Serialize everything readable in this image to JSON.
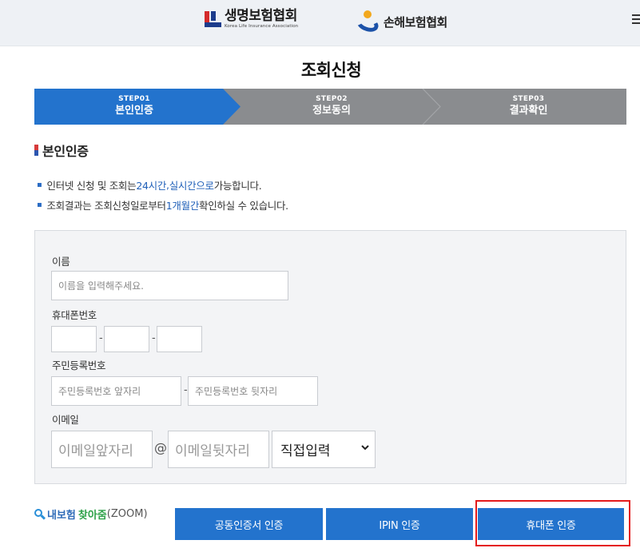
{
  "header": {
    "logo_life_kr": "생명보험협회",
    "logo_life_en": "Korea Life Insurance Association",
    "logo_nonlife": "손해보험협회"
  },
  "page": {
    "title": "조회신청"
  },
  "steps": [
    {
      "num": "STEP01",
      "label": "본인인증",
      "active": true
    },
    {
      "num": "STEP02",
      "label": "정보동의",
      "active": false
    },
    {
      "num": "STEP03",
      "label": "결과확인",
      "active": false
    }
  ],
  "colors": {
    "active_step": "#2373cd",
    "inactive_step": "#8a8c8f",
    "accent": "#2373cd",
    "highlight": "#e41b1b"
  },
  "section": {
    "title": "본인인증"
  },
  "notes": {
    "n1_a": "인터넷 신청 및 조회는 ",
    "n1_b": "24시간",
    "n1_c": ", ",
    "n1_d": "실시간으로",
    "n1_e": " 가능합니다.",
    "n2_a": "조회결과는 조회신청일로부터 ",
    "n2_b": "1개월간",
    "n2_c": " 확인하실 수 있습니다."
  },
  "form": {
    "name_label": "이름",
    "name_placeholder": "이름을 입력해주세요.",
    "phone_label": "휴대폰번호",
    "phone_sep": "-",
    "rrn_label": "주민등록번호",
    "rrn_front_placeholder": "주민등록번호 앞자리",
    "rrn_back_placeholder": "주민등록번호 뒷자리",
    "email_label": "이메일",
    "email_front_placeholder": "이메일앞자리",
    "email_at": "@",
    "email_back_placeholder": "이메일뒷자리",
    "email_domain_selected": "직접입력"
  },
  "zoom": {
    "t1": "내보험",
    "t2": "찾아줌",
    "t3": "(ZOOM)"
  },
  "buttons": {
    "cert": "공동인증서 인증",
    "ipin": "IPIN 인증",
    "phone": "휴대폰 인증"
  }
}
